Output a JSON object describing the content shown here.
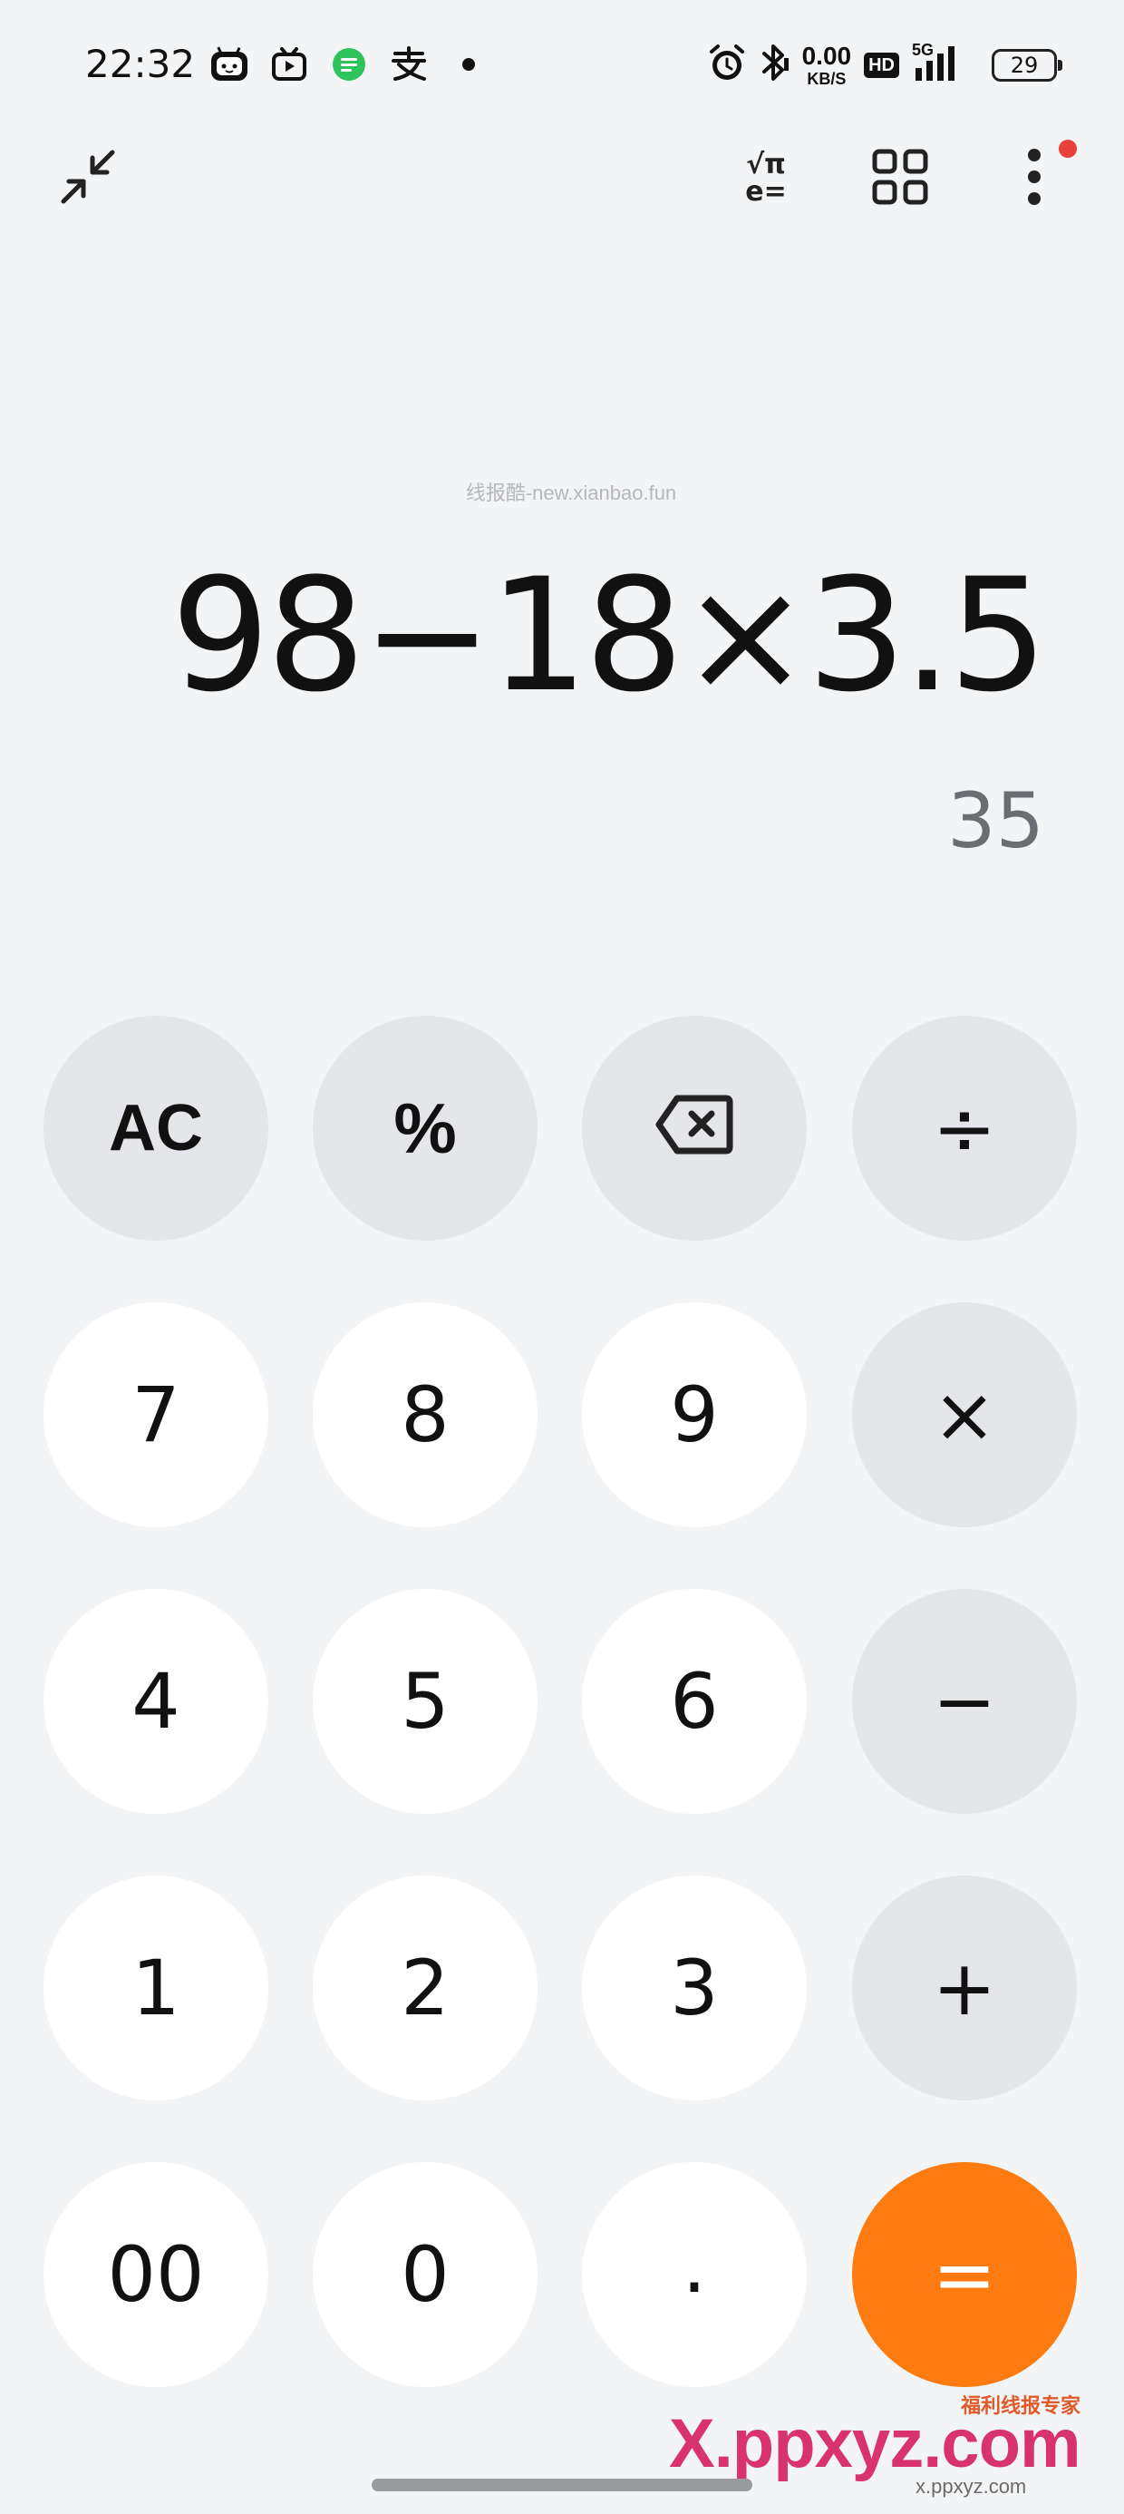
{
  "status_bar": {
    "time": "22:32",
    "net_speed_value": "0.00",
    "net_speed_unit": "KB/S",
    "hd_label": "HD",
    "network_type": "5G",
    "battery_level": "29",
    "left_icons": [
      "bilibili-tv-icon",
      "video-app-icon",
      "message-icon",
      "alipay-icon",
      "notification-dot-icon"
    ],
    "right_icons": [
      "alarm-icon",
      "bluetooth-icon",
      "signal-icon",
      "battery-icon"
    ]
  },
  "toolbar": {
    "collapse_icon": "collapse-arrows-icon",
    "scientific_label_top": "√π",
    "scientific_label_bottom": "e=",
    "grid_icon": "grid-icon",
    "more_icon": "more-vertical-icon",
    "badge_color": "#e8413a"
  },
  "display": {
    "watermark": "线报酷-new.xianbao.fun",
    "expression": "98−18×3.5",
    "result": "35"
  },
  "keypad": {
    "row1": [
      "AC",
      "%",
      "backspace-icon",
      "÷"
    ],
    "row2": [
      "7",
      "8",
      "9",
      "×"
    ],
    "row3": [
      "4",
      "5",
      "6",
      "−"
    ],
    "row4": [
      "1",
      "2",
      "3",
      "+"
    ],
    "row5": [
      "00",
      "0",
      ".",
      "="
    ],
    "ac": "AC",
    "percent": "%",
    "divide": "÷",
    "multiply": "×",
    "minus": "−",
    "plus": "+",
    "equals": "=",
    "dot": ".",
    "double_zero": "00",
    "zero": "0",
    "one": "1",
    "two": "2",
    "three": "3",
    "four": "4",
    "five": "5",
    "six": "6",
    "seven": "7",
    "eight": "8",
    "nine": "9",
    "equals_color": "#ff7b0f",
    "func_key_color": "#e5e6e9",
    "num_key_color": "#ffffff"
  },
  "watermark_brand": {
    "tag": "福利线报专家",
    "big": "X.ppxyz.com",
    "small": "x.ppxyz.com"
  }
}
